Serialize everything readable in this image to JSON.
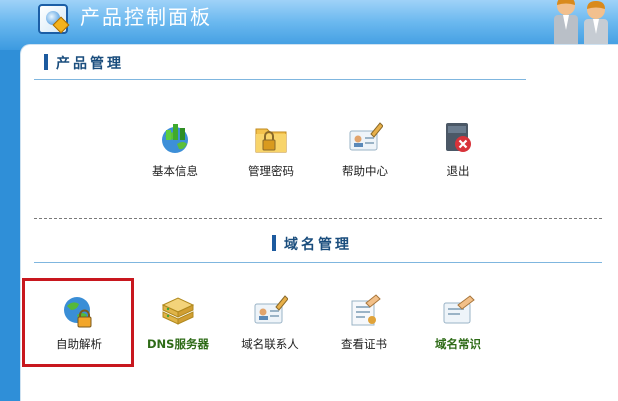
{
  "header": {
    "title": "产品控制面板",
    "logo_icon": "control-panel-logo-icon"
  },
  "product_section": {
    "title": "产品管理",
    "items": [
      {
        "label": "基本信息",
        "icon": "globe-chart-icon"
      },
      {
        "label": "管理密码",
        "icon": "folder-lock-icon"
      },
      {
        "label": "帮助中心",
        "icon": "id-card-pen-icon"
      },
      {
        "label": "退出",
        "icon": "exit-icon"
      }
    ]
  },
  "domain_section": {
    "title": "域名管理",
    "items": [
      {
        "label": "自助解析",
        "icon": "globe-lock-icon"
      },
      {
        "label": "DNS服务器",
        "icon": "server-stack-icon"
      },
      {
        "label": "域名联系人",
        "icon": "contact-card-pen-icon"
      },
      {
        "label": "查看证书",
        "icon": "certificate-icon"
      },
      {
        "label": "域名常识",
        "icon": "knowledge-card-icon"
      }
    ]
  },
  "colors": {
    "header_top": "#9fd2f8",
    "header_bottom": "#3c9ae0",
    "section_title": "#1a4d7d",
    "highlight_border": "#c8171e",
    "green_label": "#2e6b17"
  }
}
